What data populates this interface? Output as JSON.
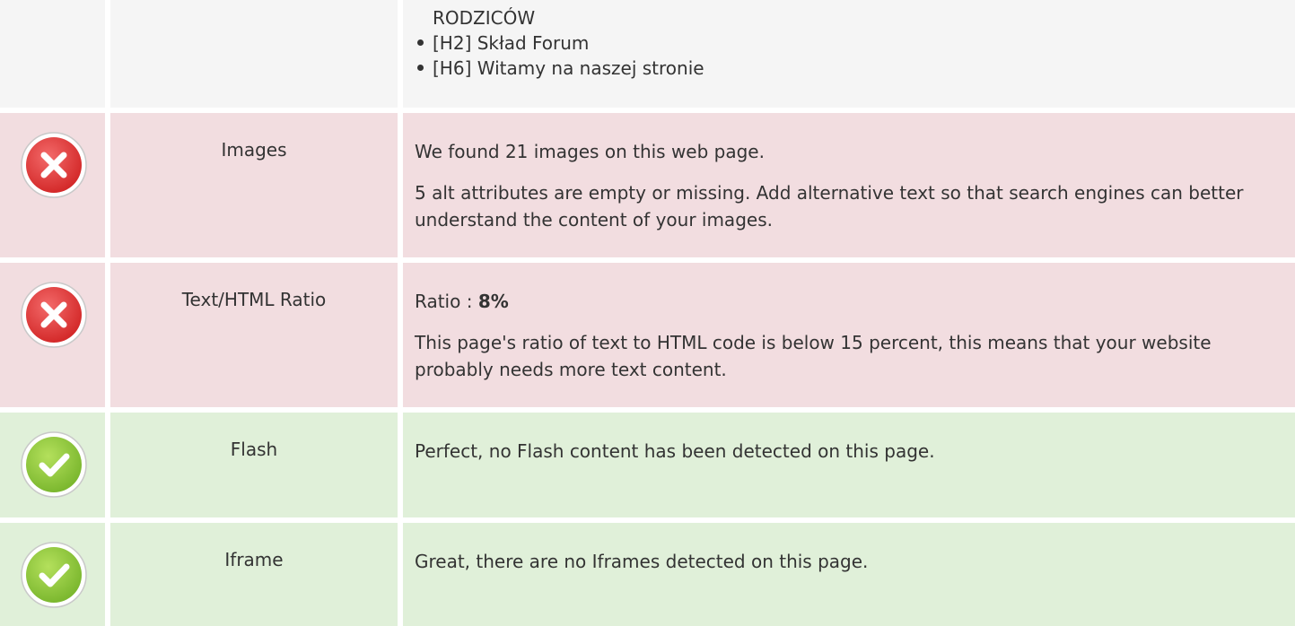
{
  "headings_row": {
    "items": [
      {
        "text": "RODZICÓW",
        "bullet": false
      },
      {
        "text": "[H2] Skład Forum",
        "bullet": true
      },
      {
        "text": "[H6] Witamy na naszej stronie",
        "bullet": true
      }
    ]
  },
  "rows": [
    {
      "status": "error",
      "icon": "error-icon",
      "label": "Images",
      "paragraphs": [
        "We found 21 images on this web page.",
        "5 alt attributes are empty or missing. Add alternative text so that search engines can better understand the content of your images."
      ]
    },
    {
      "status": "error",
      "icon": "error-icon",
      "label": "Text/HTML Ratio",
      "ratio_prefix": "Ratio : ",
      "ratio_value": "8%",
      "paragraphs": [
        "This page's ratio of text to HTML code is below 15 percent, this means that your website probably needs more text content."
      ]
    },
    {
      "status": "success",
      "icon": "check-icon",
      "label": "Flash",
      "paragraphs": [
        "Perfect, no Flash content has been detected on this page."
      ]
    },
    {
      "status": "success",
      "icon": "check-icon",
      "label": "Iframe",
      "paragraphs": [
        "Great, there are no Iframes detected on this page."
      ]
    }
  ],
  "colors": {
    "error_bg": "#f2dde0",
    "success_bg": "#e0f0d9",
    "neutral_bg": "#f5f5f5",
    "error_icon": "#e23c3c",
    "success_icon": "#8cc63f"
  }
}
